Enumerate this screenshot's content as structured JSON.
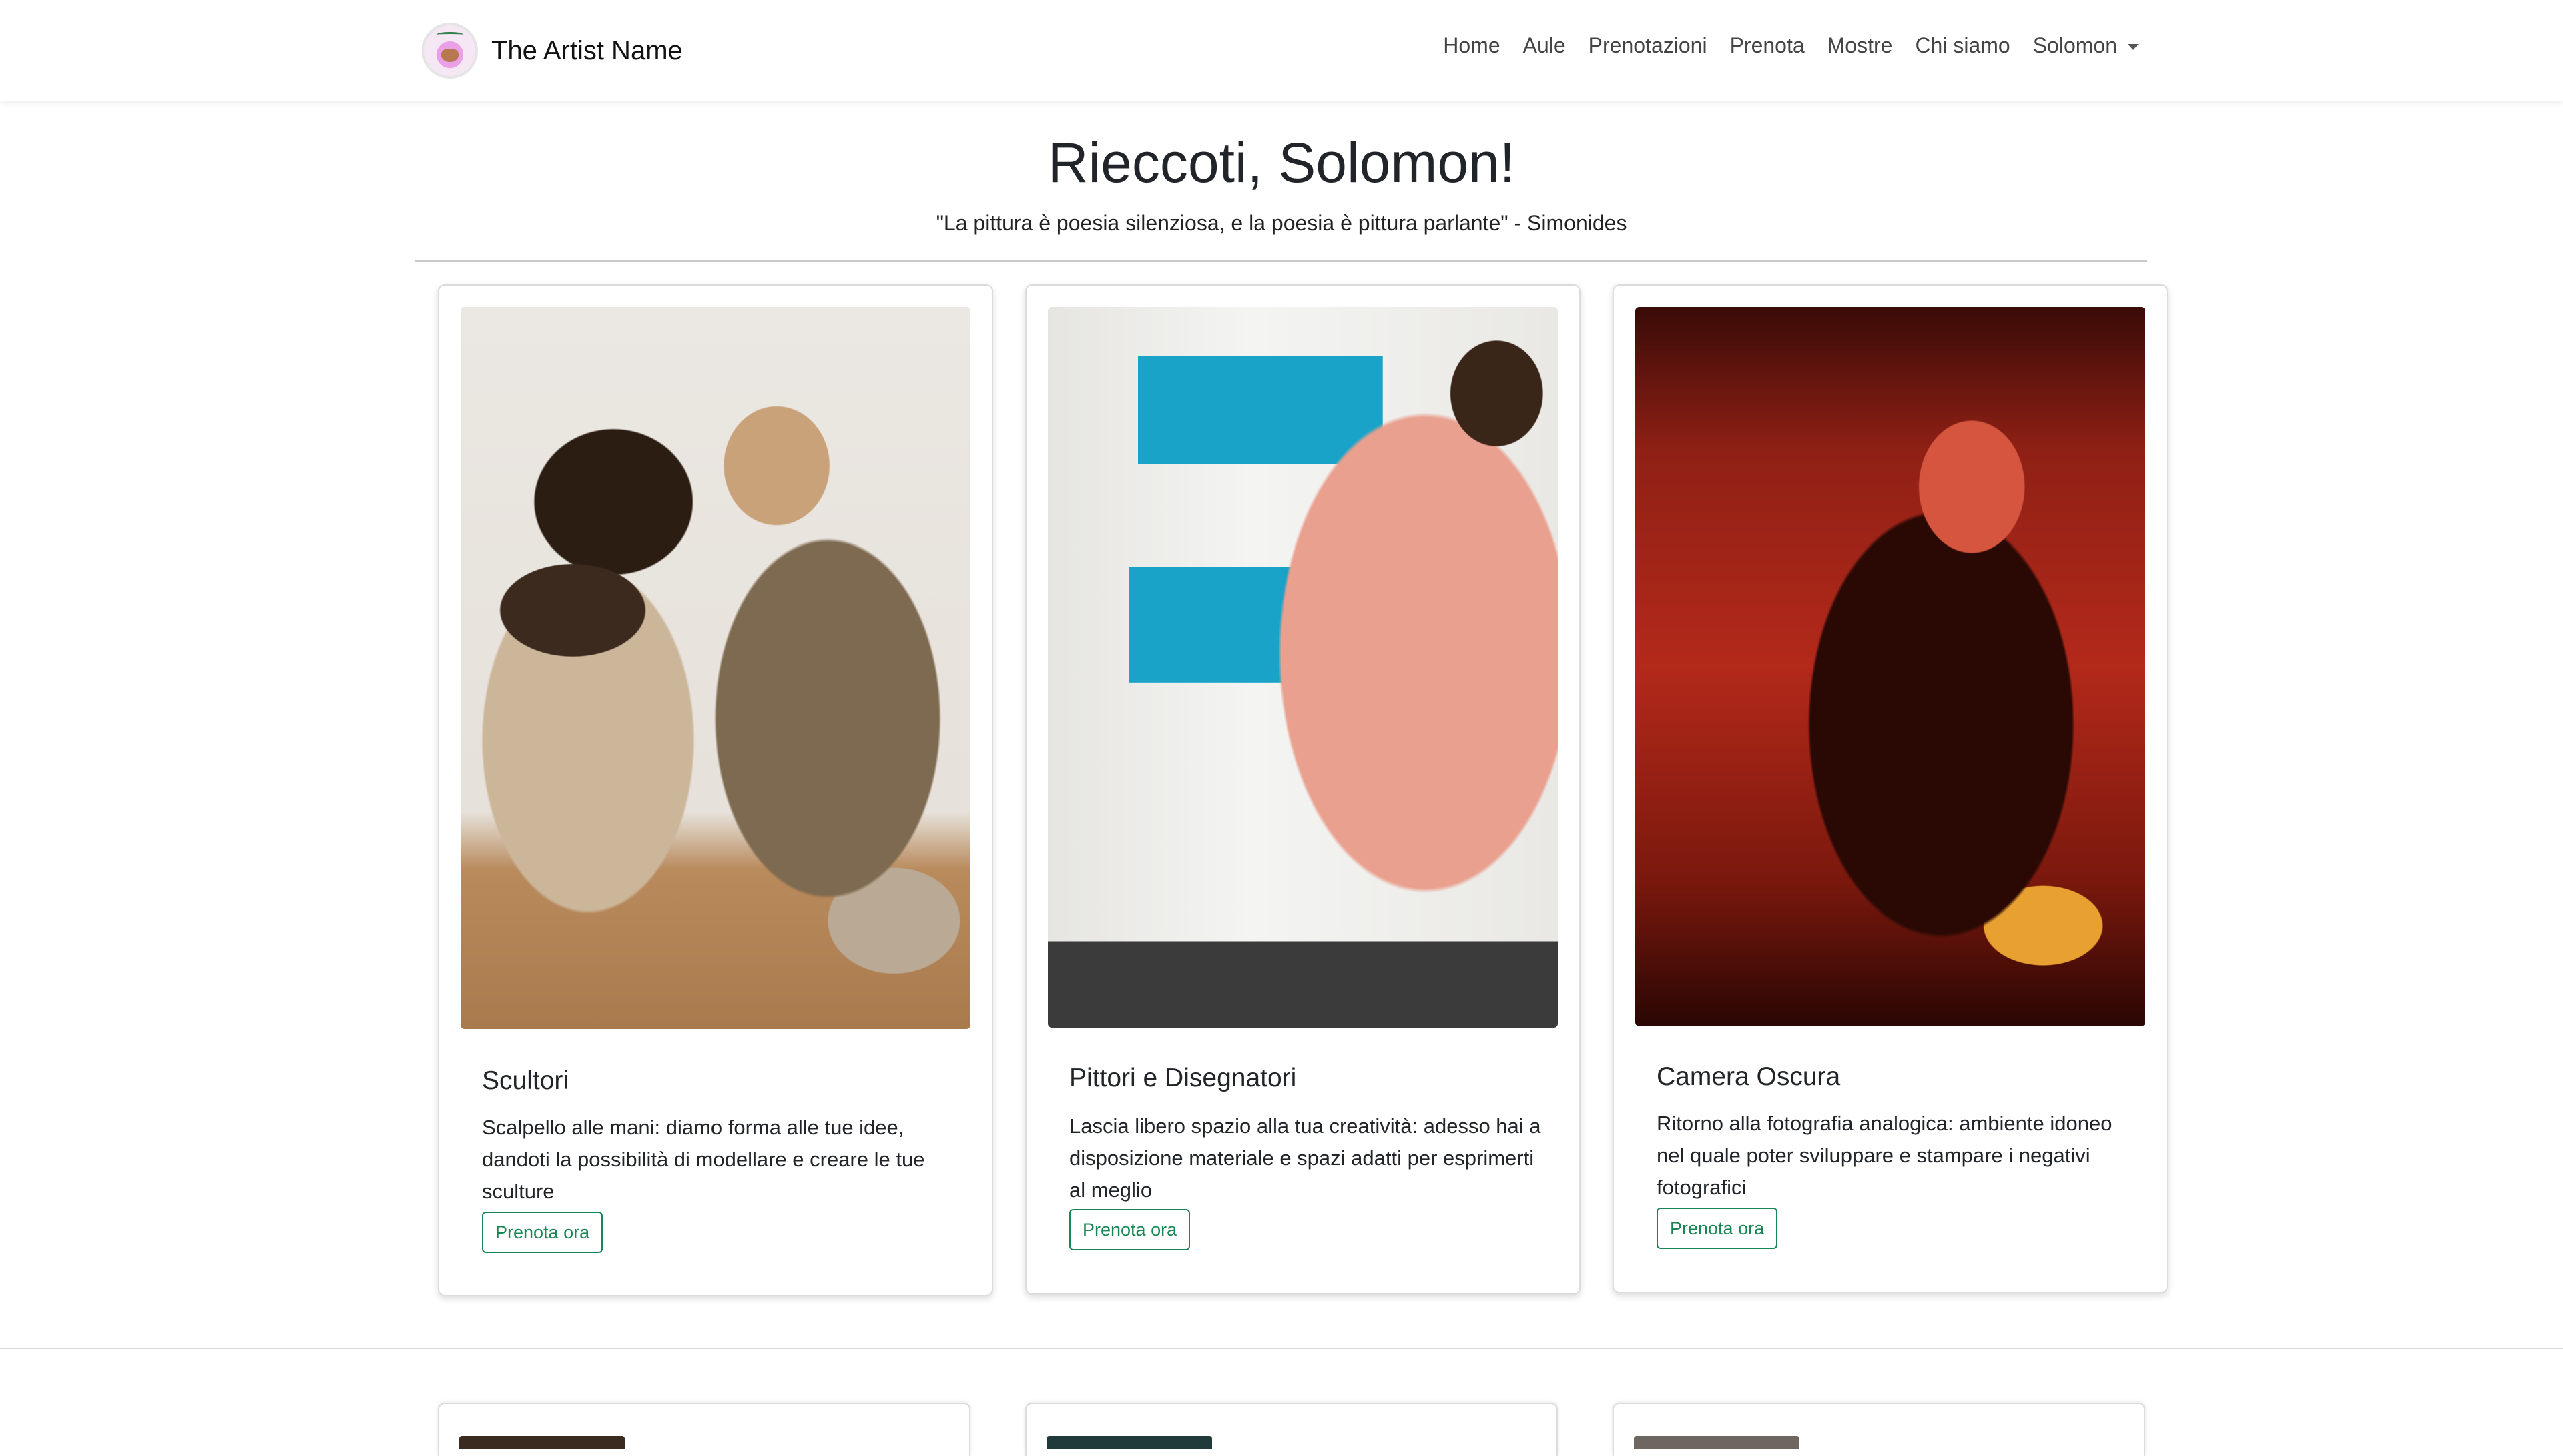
{
  "navbar": {
    "brand_name": "The Artist Name",
    "links": [
      "Home",
      "Aule",
      "Prenotazioni",
      "Prenota",
      "Mostre",
      "Chi siamo"
    ],
    "user_menu_label": "Solomon"
  },
  "hero": {
    "title": "Rieccoti, Solomon!",
    "quote": "\"La pittura è poesia silenziosa, e la poesia è pittura parlante\" - Simonides"
  },
  "cards": [
    {
      "title": "Scultori",
      "text": "Scalpello alle mani: diamo forma alle tue idee, dandoti la possibilità di modellare e creare le tue sculture",
      "button_label": "Prenota ora"
    },
    {
      "title": "Pittori e Disegnatori",
      "text": "Lascia libero spazio alla tua creatività: adesso hai a disposizione materiale e spazi adatti per esprimerti al meglio",
      "button_label": "Prenota ora"
    },
    {
      "title": "Camera Oscura",
      "text": "Ritorno alla fotografia analogica: ambiente idoneo nel quale poter sviluppare e stampare i negativi fotografici",
      "button_label": "Prenota ora"
    }
  ],
  "colors": {
    "accent_green": "#198754",
    "text_dark": "#212529",
    "divider": "#c9c9c9"
  }
}
